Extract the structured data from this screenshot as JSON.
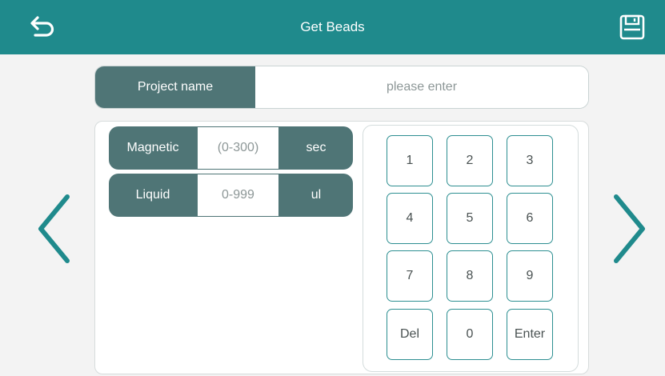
{
  "header": {
    "title": "Get Beads",
    "back_icon": "back-arrow-icon",
    "save_icon": "save-icon",
    "bg_color": "#1f8a8c"
  },
  "project": {
    "label": "Project name",
    "placeholder": "please enter",
    "value": ""
  },
  "params": {
    "magnetic": {
      "label": "Magnetic",
      "placeholder": "(0-300)",
      "unit": "sec"
    },
    "liquid": {
      "label": "Liquid",
      "placeholder": "0-999",
      "unit": "ul"
    }
  },
  "keypad": {
    "keys": [
      "1",
      "2",
      "3",
      "4",
      "5",
      "6",
      "7",
      "8",
      "9",
      "Del",
      "0",
      "Enter"
    ]
  },
  "navigation": {
    "prev_icon": "chevron-left-icon",
    "next_icon": "chevron-right-icon"
  },
  "colors": {
    "accent": "#1f8a8c",
    "label_bg": "#4f7576",
    "key_border": "#2d8f91"
  }
}
